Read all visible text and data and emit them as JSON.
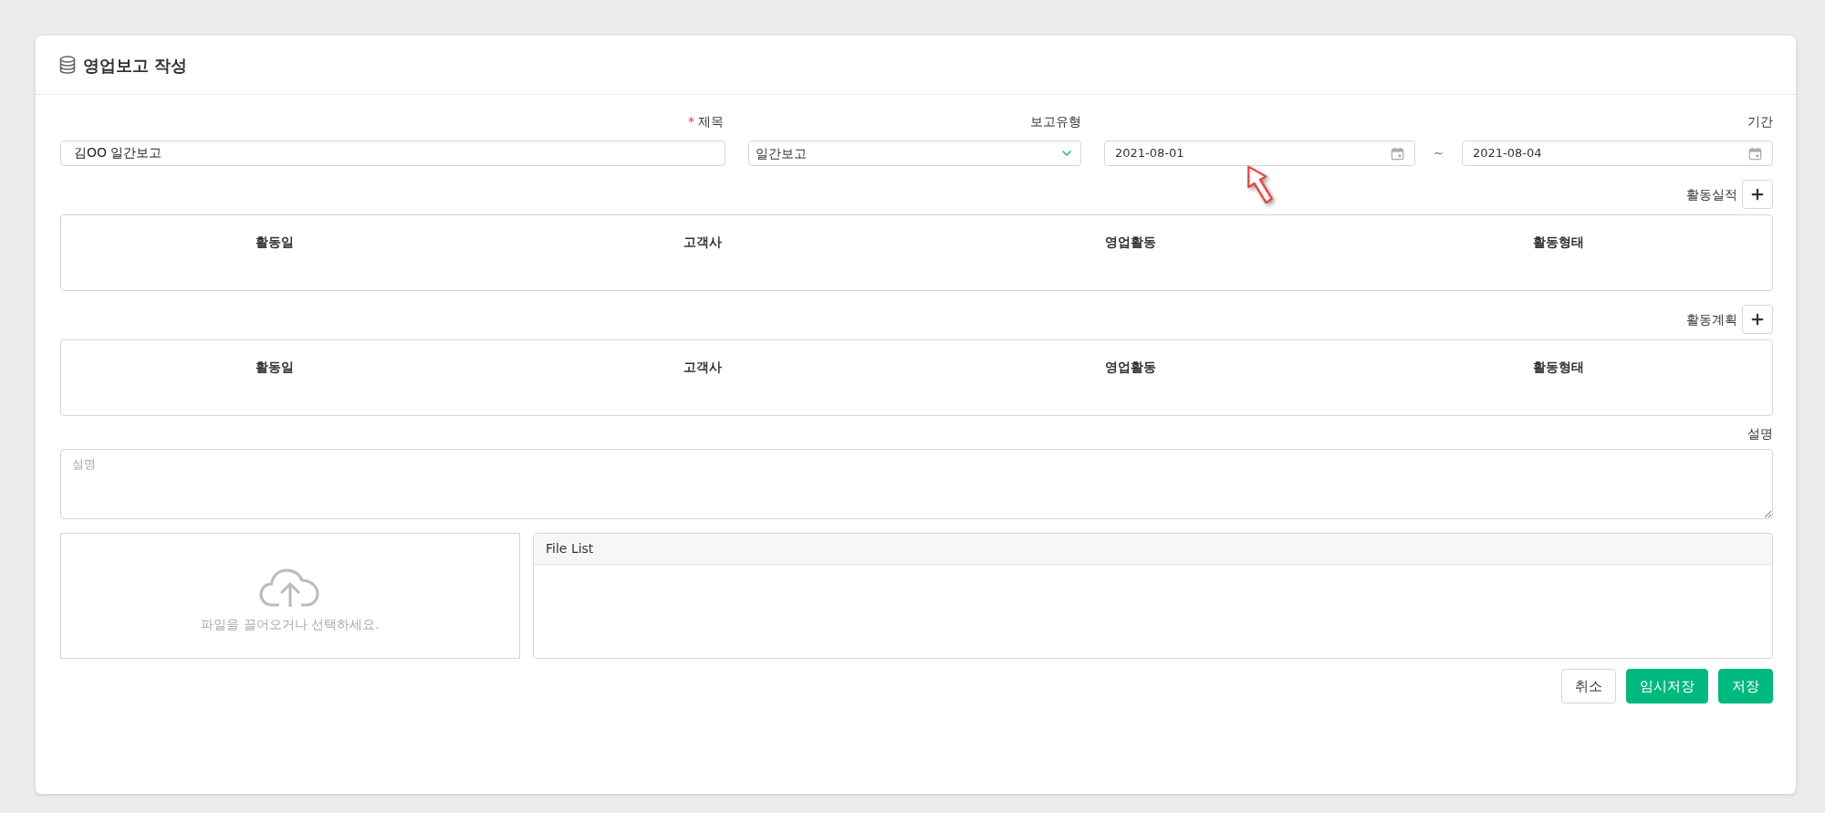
{
  "header": {
    "title": "영업보고 작성"
  },
  "title_field": {
    "required_mark": "*",
    "label": "제목",
    "value": "김OO 일간보고"
  },
  "report_type": {
    "label": "보고유형",
    "value": "일간보고"
  },
  "period": {
    "label": "기간",
    "start": "2021-08-01",
    "separator": "~",
    "end": "2021-08-04"
  },
  "sections": [
    {
      "label": "활동실적",
      "columns": [
        "활동일",
        "고객사",
        "영업활동",
        "활동형태"
      ]
    },
    {
      "label": "활동계획",
      "columns": [
        "활동일",
        "고객사",
        "영업활동",
        "활동형태"
      ]
    }
  ],
  "description": {
    "label": "설명",
    "placeholder": "설명"
  },
  "upload": {
    "text": "파일을 끌어오거나 선택하세요."
  },
  "file_list": {
    "title": "File List"
  },
  "buttons": [
    {
      "label": "취소",
      "kind": "secondary"
    },
    {
      "label": "임시저장",
      "kind": "primary"
    },
    {
      "label": "저장",
      "kind": "primary"
    }
  ]
}
